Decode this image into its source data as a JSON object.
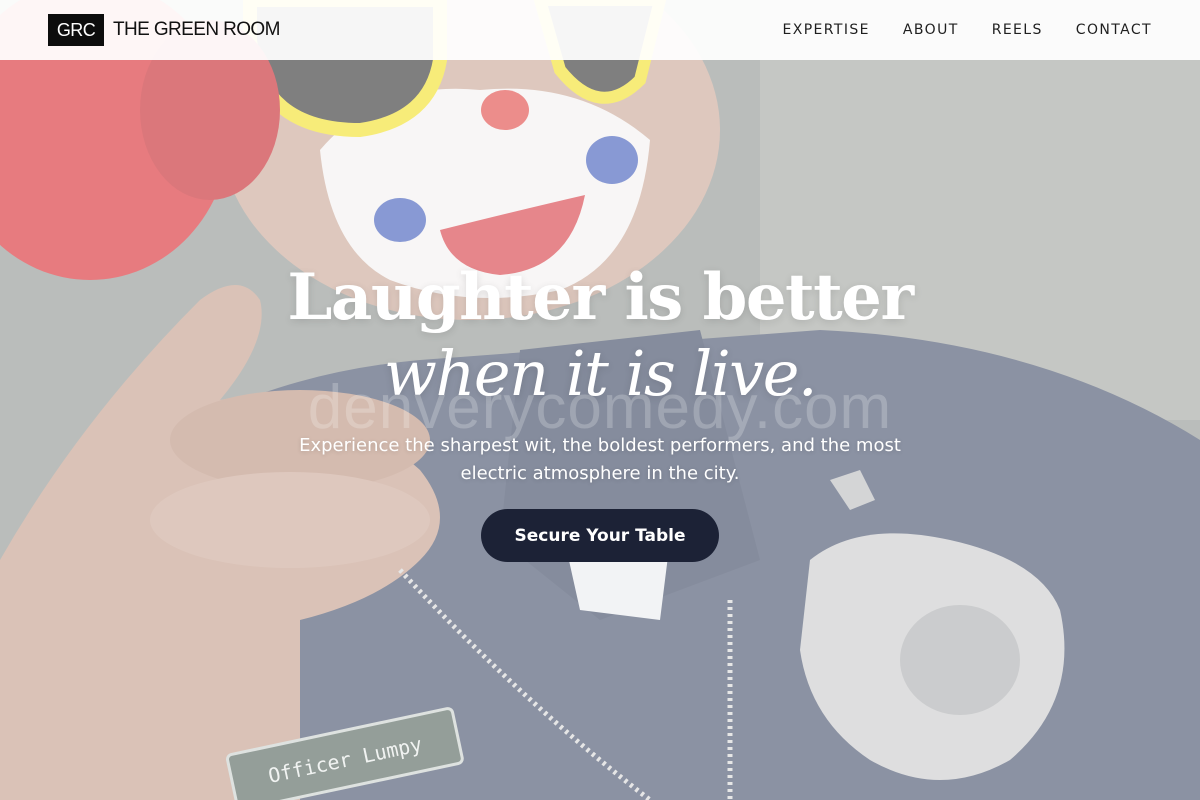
{
  "brand": {
    "logo_text": "GRC",
    "name": "THE GREEN ROOM"
  },
  "nav": {
    "items": [
      {
        "label": "EXPERTISE"
      },
      {
        "label": "ABOUT"
      },
      {
        "label": "REELS"
      },
      {
        "label": "CONTACT"
      }
    ]
  },
  "hero": {
    "headline_line1": "Laughter is better",
    "headline_line2": "when it is live.",
    "subtext": "Experience the sharpest wit, the boldest performers, and the most electric atmosphere in the city.",
    "cta_label": "Secure Your Table",
    "watermark": "denverycomedy.com",
    "image_badge_text": "Officer Lumpy"
  },
  "colors": {
    "cta_background": "#1c2236",
    "nav_text": "#1f1f1f",
    "logo_background": "#0d0d0d",
    "headline": "#ffffff"
  }
}
